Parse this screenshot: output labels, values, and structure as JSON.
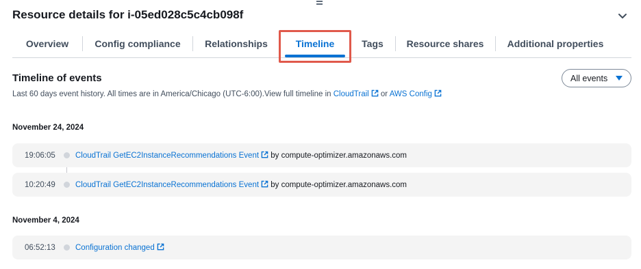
{
  "header": {
    "title": "Resource details for i-05ed028c5c4cb098f"
  },
  "tabs": [
    {
      "label": "Overview"
    },
    {
      "label": "Config compliance"
    },
    {
      "label": "Relationships"
    },
    {
      "label": "Timeline"
    },
    {
      "label": "Tags"
    },
    {
      "label": "Resource shares"
    },
    {
      "label": "Additional properties"
    }
  ],
  "active_tab": "Timeline",
  "timeline": {
    "title": "Timeline of events",
    "description_prefix": "Last 60 days event history.  All times are in America/Chicago (UTC-6:00).View full timeline in ",
    "cloudtrail_link": "CloudTrail",
    "or_text": " or ",
    "awsconfig_link": "AWS Config",
    "filter_label": "All events",
    "groups": [
      {
        "date": "November 24, 2024",
        "events": [
          {
            "time": "19:06:05",
            "link": "CloudTrail GetEC2InstanceRecommendations Event",
            "suffix": " by compute-optimizer.amazonaws.com"
          },
          {
            "time": "10:20:49",
            "link": "CloudTrail GetEC2InstanceRecommendations Event",
            "suffix": " by compute-optimizer.amazonaws.com"
          }
        ]
      },
      {
        "date": "November 4, 2024",
        "events": [
          {
            "time": "06:52:13",
            "link": "Configuration changed",
            "suffix": ""
          }
        ]
      }
    ]
  },
  "colors": {
    "link": "#0972d3",
    "highlight": "#e0594b",
    "row_bg": "#f4f4f4"
  }
}
